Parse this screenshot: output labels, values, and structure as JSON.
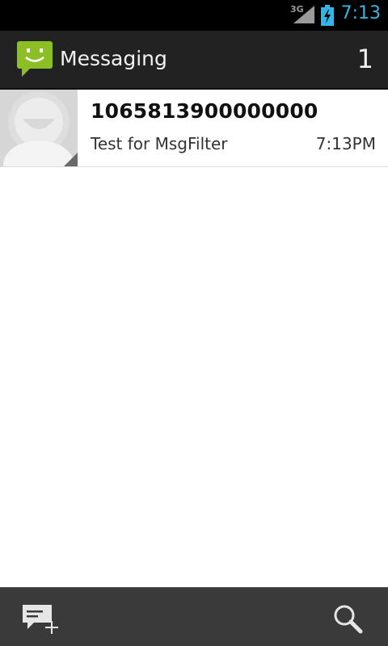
{
  "status_bar": {
    "network_type": "3G",
    "time": "7:13",
    "icons": [
      "signal-icon",
      "battery-charging-icon"
    ]
  },
  "action_bar": {
    "app_icon": "messaging-smiley-icon",
    "title": "Messaging",
    "unread_count": "1"
  },
  "conversations": [
    {
      "sender": "1065813900000000",
      "snippet": "Test for MsgFilter",
      "time": "7:13PM",
      "avatar": "default-contact-avatar"
    }
  ],
  "bottom_bar": {
    "actions": [
      {
        "name": "compose-new-message",
        "icon": "compose-icon"
      },
      {
        "name": "search",
        "icon": "search-icon"
      }
    ]
  },
  "colors": {
    "status_bar_bg": "#000000",
    "clock": "#33b5e5",
    "action_bar_bg": "#222222",
    "app_icon_green": "#8cbf26",
    "list_bg": "#ffffff",
    "bottom_bar_bg": "#3a3a3a"
  }
}
